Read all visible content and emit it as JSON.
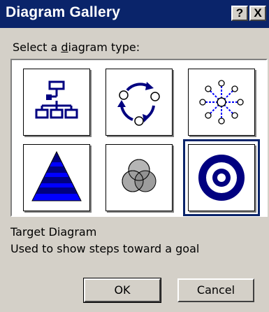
{
  "window": {
    "title": "Diagram Gallery"
  },
  "titlebar": {
    "help_label": "?",
    "close_label": "X"
  },
  "gallery": {
    "prompt_before": "Select a ",
    "prompt_underlined": "d",
    "prompt_after": "iagram type:",
    "items": [
      {
        "name": "Organization Chart",
        "icon": "org-chart-icon",
        "selected": false
      },
      {
        "name": "Cycle Diagram",
        "icon": "cycle-diagram-icon",
        "selected": false
      },
      {
        "name": "Radial Diagram",
        "icon": "radial-diagram-icon",
        "selected": false
      },
      {
        "name": "Pyramid Diagram",
        "icon": "pyramid-diagram-icon",
        "selected": false
      },
      {
        "name": "Venn Diagram",
        "icon": "venn-diagram-icon",
        "selected": false
      },
      {
        "name": "Target Diagram",
        "icon": "target-diagram-icon",
        "selected": true
      }
    ]
  },
  "selection": {
    "name": "Target Diagram",
    "description": "Used to show steps toward a goal"
  },
  "buttons": {
    "ok_label": "OK",
    "cancel_label": "Cancel"
  },
  "colors": {
    "titlebar": "#0a246a",
    "accent": "#0000ff",
    "dark_blue": "#000080",
    "face": "#d4d0c8"
  }
}
